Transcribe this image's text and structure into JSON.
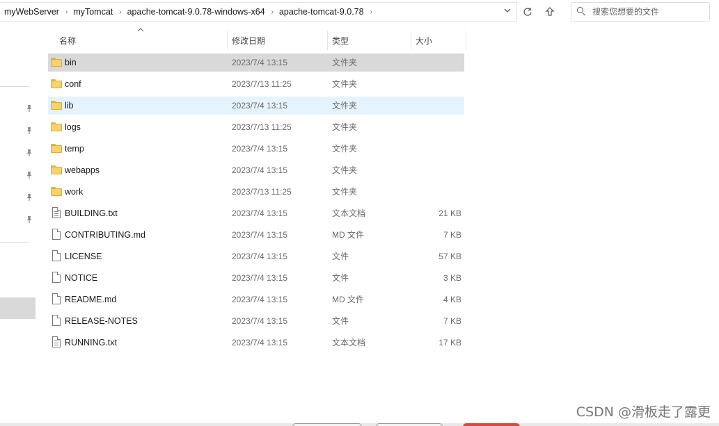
{
  "address_bar": {
    "crumbs": [
      "myWebServer",
      "myTomcat",
      "apache-tomcat-9.0.78-windows-x64",
      "apache-tomcat-9.0.78"
    ],
    "separator": "›"
  },
  "search": {
    "placeholder": "搜索您想要的文件"
  },
  "columns": {
    "name": "名称",
    "date": "修改日期",
    "type": "类型",
    "size": "大小"
  },
  "files": [
    {
      "name": "bin",
      "date": "2023/7/4 13:15",
      "type": "文件夹",
      "size": "",
      "kind": "folder",
      "state": "selected"
    },
    {
      "name": "conf",
      "date": "2023/7/13 11:25",
      "type": "文件夹",
      "size": "",
      "kind": "folder",
      "state": ""
    },
    {
      "name": "lib",
      "date": "2023/7/4 13:15",
      "type": "文件夹",
      "size": "",
      "kind": "folder",
      "state": "hover"
    },
    {
      "name": "logs",
      "date": "2023/7/13 11:25",
      "type": "文件夹",
      "size": "",
      "kind": "folder",
      "state": ""
    },
    {
      "name": "temp",
      "date": "2023/7/4 13:15",
      "type": "文件夹",
      "size": "",
      "kind": "folder",
      "state": ""
    },
    {
      "name": "webapps",
      "date": "2023/7/4 13:15",
      "type": "文件夹",
      "size": "",
      "kind": "folder",
      "state": ""
    },
    {
      "name": "work",
      "date": "2023/7/13 11:25",
      "type": "文件夹",
      "size": "",
      "kind": "folder",
      "state": ""
    },
    {
      "name": "BUILDING.txt",
      "date": "2023/7/4 13:15",
      "type": "文本文档",
      "size": "21 KB",
      "kind": "text",
      "state": ""
    },
    {
      "name": "CONTRIBUTING.md",
      "date": "2023/7/4 13:15",
      "type": "MD 文件",
      "size": "7 KB",
      "kind": "file",
      "state": ""
    },
    {
      "name": "LICENSE",
      "date": "2023/7/4 13:15",
      "type": "文件",
      "size": "57 KB",
      "kind": "file",
      "state": ""
    },
    {
      "name": "NOTICE",
      "date": "2023/7/4 13:15",
      "type": "文件",
      "size": "3 KB",
      "kind": "file",
      "state": ""
    },
    {
      "name": "README.md",
      "date": "2023/7/4 13:15",
      "type": "MD 文件",
      "size": "4 KB",
      "kind": "file",
      "state": ""
    },
    {
      "name": "RELEASE-NOTES",
      "date": "2023/7/4 13:15",
      "type": "文件",
      "size": "7 KB",
      "kind": "file",
      "state": ""
    },
    {
      "name": "RUNNING.txt",
      "date": "2023/7/4 13:15",
      "type": "文本文档",
      "size": "17 KB",
      "kind": "text",
      "state": ""
    }
  ],
  "watermark": "CSDN @滑板走了露更",
  "icons": {
    "dropdown": "chevron-down-icon",
    "refresh": "refresh-icon",
    "up": "up-arrow-icon",
    "search": "search-icon",
    "pin": "pin-icon",
    "folder": "folder-icon",
    "file": "file-icon"
  }
}
